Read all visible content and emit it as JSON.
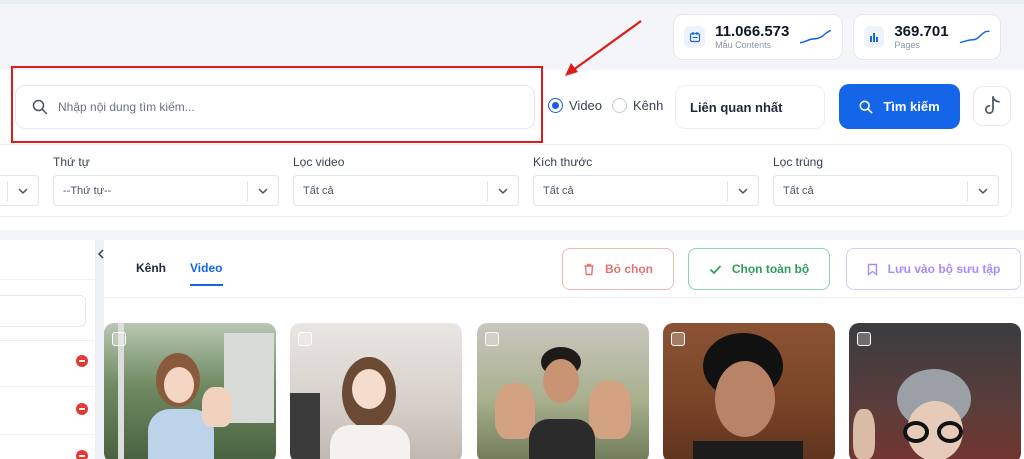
{
  "stats": [
    {
      "value": "11.066.573",
      "label": "Mẫu Contents",
      "icon": "calendar-icon"
    },
    {
      "value": "369.701",
      "label": "Pages",
      "icon": "bar-chart-icon"
    }
  ],
  "search": {
    "placeholder": "Nhập nội dung tìm kiếm...",
    "value": "",
    "type_options": [
      {
        "label": "Video",
        "selected": true
      },
      {
        "label": "Kênh",
        "selected": false
      }
    ],
    "sort": "Liên quan nhất",
    "button_label": "Tìm kiếm"
  },
  "filters": [
    {
      "label": "Thứ tự",
      "value": "--Thứ tự--"
    },
    {
      "label": "Lọc video",
      "value": "Tất cả"
    },
    {
      "label": "Kích thước",
      "value": "Tất cả"
    },
    {
      "label": "Lọc trùng",
      "value": "Tất cả"
    }
  ],
  "content": {
    "tabs": [
      {
        "label": "Kênh",
        "active": false
      },
      {
        "label": "Video",
        "active": true
      }
    ],
    "actions": {
      "deselect": "Bỏ chọn",
      "select_all": "Chọn toàn bộ",
      "save_collection": "Lưu vào bộ sưu tập"
    }
  },
  "colors": {
    "primary": "#1565e8",
    "annotation_red": "#e01b1b",
    "deselect": "#e57373",
    "select_all": "#2e9e5b",
    "save": "#a78bfa"
  }
}
